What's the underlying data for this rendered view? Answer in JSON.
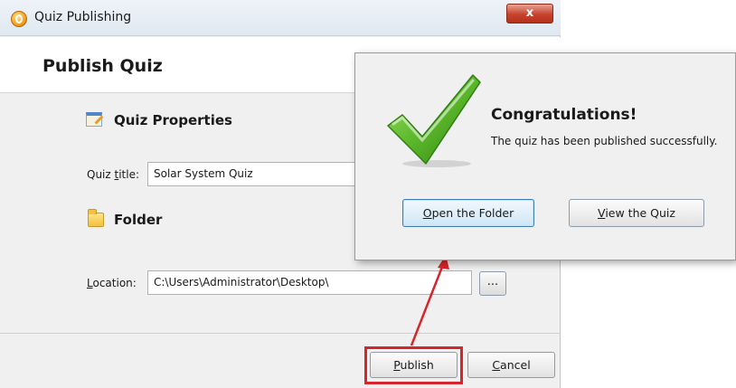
{
  "window": {
    "title": "Quiz Publishing",
    "close_label": "x"
  },
  "header": {
    "title": "Publish Quiz"
  },
  "quiz_properties": {
    "section_label": "Quiz Properties",
    "title_label_prefix": "Quiz ",
    "title_label_mnemonic": "t",
    "title_label_suffix": "itle:",
    "title_value": "Solar System Quiz"
  },
  "folder": {
    "section_label": "Folder",
    "location_label_mnemonic": "L",
    "location_label_suffix": "ocation:",
    "location_value": "C:\\Users\\Administrator\\Desktop\\",
    "browse_label": "..."
  },
  "footer": {
    "publish_mnemonic": "P",
    "publish_suffix": "ublish",
    "cancel_mnemonic": "C",
    "cancel_suffix": "ancel"
  },
  "popup": {
    "heading": "Congratulations!",
    "message": "The quiz has been published successfully.",
    "open_folder_mnemonic": "O",
    "open_folder_suffix": "pen the Folder",
    "view_quiz_mnemonic": "V",
    "view_quiz_suffix": "iew the Quiz"
  },
  "colors": {
    "highlight": "#d7262b",
    "check_green": "#5cb82a",
    "close_button": "#c7432d"
  },
  "icons": {
    "app": "quiz-app-icon",
    "quiz_properties": "quiz-properties-icon",
    "folder": "folder-icon",
    "success": "checkmark-icon"
  }
}
